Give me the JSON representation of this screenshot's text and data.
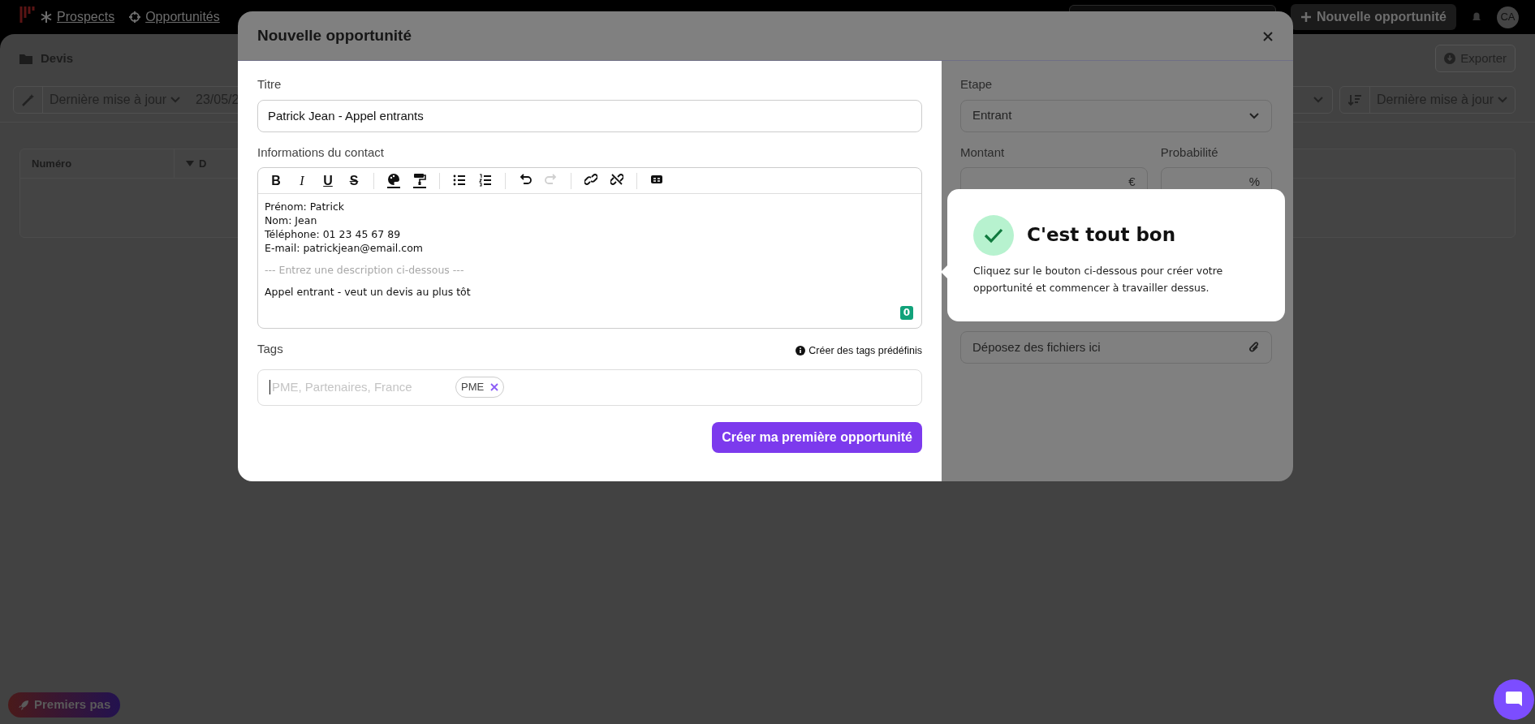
{
  "top_nav": {
    "items": [
      "Prospects",
      "Opportunités"
    ],
    "new_button": "Nouvelle opportunité",
    "avatar": "CA"
  },
  "page": {
    "title": "Devis",
    "export_button": "Exporter",
    "filter_sort": "Dernière mise à jour",
    "filter_date": "23/05/2",
    "sort_label": "Dernière mise à jour",
    "columns": [
      "Numéro",
      "D"
    ]
  },
  "modal": {
    "title": "Nouvelle opportunité",
    "title_field": {
      "label": "Titre",
      "value": "Patrick Jean - Appel entrants"
    },
    "contact": {
      "label": "Informations du contact",
      "toolbar": [
        {
          "kind": "bold",
          "label": "B",
          "disabled": false
        },
        {
          "kind": "italic",
          "label": "I",
          "disabled": false
        },
        {
          "kind": "underline",
          "label": "U",
          "disabled": false
        },
        {
          "kind": "strike",
          "label": "S",
          "disabled": false
        },
        {
          "kind": "separator"
        },
        {
          "kind": "palette",
          "disabled": false
        },
        {
          "kind": "roller",
          "disabled": false
        },
        {
          "kind": "separator"
        },
        {
          "kind": "bullets",
          "disabled": false
        },
        {
          "kind": "numbers",
          "disabled": false
        },
        {
          "kind": "separator"
        },
        {
          "kind": "undo",
          "disabled": false
        },
        {
          "kind": "redo",
          "disabled": true
        },
        {
          "kind": "separator"
        },
        {
          "kind": "link",
          "disabled": false
        },
        {
          "kind": "unlink",
          "disabled": false
        },
        {
          "kind": "separator"
        },
        {
          "kind": "card",
          "disabled": false
        }
      ],
      "lines": [
        "Prénom: Patrick",
        "Nom: Jean",
        "Téléphone: 01 23 45 67 89",
        "E-mail: patrickjean@email.com"
      ],
      "separator": "--- Entrez une description ci-dessous ---",
      "description": "Appel entrant - veut un devis au plus tôt",
      "counter": "0"
    },
    "tags": {
      "label": "Tags",
      "help_link": "Créer des tags prédéfinis",
      "placeholder": "PME, Partenaires, France",
      "chips": [
        "PME"
      ]
    },
    "submit": "Créer ma première opportunité",
    "side": {
      "stage": {
        "label": "Etape",
        "value": "Entrant"
      },
      "amount": {
        "label": "Montant",
        "unit": "€"
      },
      "probability": {
        "label": "Probabilité",
        "unit": "%"
      },
      "files": {
        "label": "Déposez des fichiers ici"
      }
    }
  },
  "tooltip": {
    "title": "C'est tout bon",
    "text": "Cliquez sur le bouton ci-dessous pour créer votre opportunité et commencer à travailler dessus."
  },
  "getting_started": "Premiers pas"
}
